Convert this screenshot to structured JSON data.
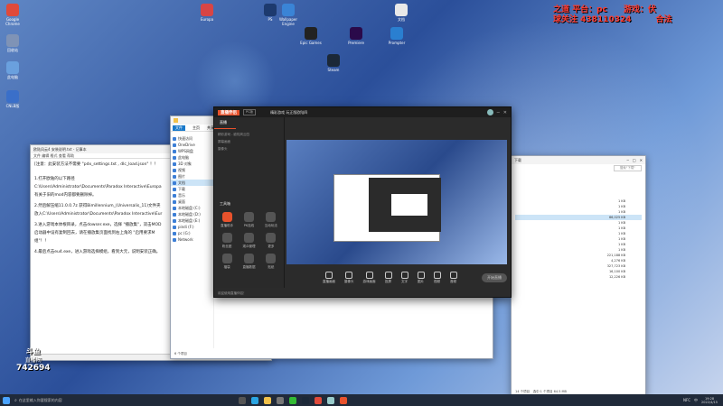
{
  "overlay": {
    "line1": "之道 平台：pc　　游戏：伏",
    "line2": "球关注 438110324　　　合法"
  },
  "desktop_icons": [
    {
      "label": "Google Chrome",
      "color": "#e04a3b"
    },
    {
      "label": "回收站",
      "color": "#7f93b6"
    },
    {
      "label": "此电脑",
      "color": "#6aa0de"
    },
    {
      "label": "CNLB版",
      "color": "#3a6fc9"
    },
    {
      "label": "Wallpaper Engine",
      "color": "#3a84d6"
    },
    {
      "label": "Epic Games",
      "color": "#222"
    },
    {
      "label": "Steam",
      "color": "#1b2838"
    },
    {
      "label": "Premiere",
      "color": "#2a0a4a"
    },
    {
      "label": "Prompter",
      "color": "#2a7fd0"
    },
    {
      "label": "Europa",
      "color": "#d84545"
    },
    {
      "label": "PS",
      "color": "#1d3a6e"
    },
    {
      "label": "文档",
      "color": "#e8e8e8"
    }
  ],
  "notepad": {
    "title": "欧陆风云4 安装说明.txt - 记事本",
    "lines": [
      "[注意：此安装方法不需要 \"pdx_settings.txt , dlc_load.json\" ！！",
      "1.打开欧陆的以下路径",
      "C:\\Users\\Administrator\\Documents\\Paradox Interactive\\Europa",
      "有关于旧的mod内容都要删除掉。",
      "2.然后解压缩11.0.0.7z 获得Bimillennium_(Universalis_11)文件夹",
      "放入C:\\Users\\Administrator\\Documents\\Paradox Interactive\\Eur",
      "3.进入游戏本体根目录，点击dowser.exe，选择 \"播放集\"，双击MOD",
      "启动器中设有复制回去，请在播放集页面找到右上角的 \"启用要求M",
      "组\"！！",
      "4.最后点击eu4.exe，进入游戏选择模组，看到大元，说明安装正确。"
    ],
    "status": [
      "第 1 行，第 1 列",
      "100%",
      "Windows (CRLF)",
      "ANSI"
    ]
  },
  "explorer": {
    "sidebar": [
      "快速访问",
      "OneDrive",
      "WPS网盘",
      "此电脑",
      "3D 对象",
      "视频",
      "图片",
      "文档",
      "下载",
      "音乐",
      "桌面",
      "本地磁盘 (C:)",
      "本地磁盘 (D:)",
      "本地磁盘 (E:)",
      "pindi (F:)",
      "pc (G:)",
      "Network"
    ],
    "selected_index": 7,
    "status": "6 个项目"
  },
  "streaming_app": {
    "title": "直播伴侣",
    "tab": "直播",
    "badge": "PC版",
    "stream_title": "精彩游戏 玩正版欧陆四",
    "scene_items": [
      "精彩游戏 - 欧陆风云四",
      "屏幕画面",
      "摄像头"
    ],
    "tools_header": "工具箱",
    "tools": [
      {
        "label": "直播助手",
        "color": "#e8522c"
      },
      {
        "label": "PK连线",
        "color": "#555"
      },
      {
        "label": "互动玩法",
        "color": "#555"
      },
      {
        "label": "粉丝团",
        "color": "#555"
      },
      {
        "label": "观众管理",
        "color": "#555"
      },
      {
        "label": "更多",
        "color": "#555"
      },
      {
        "label": "福袋",
        "color": "#555"
      },
      {
        "label": "直播数据",
        "color": "#555"
      },
      {
        "label": "贴纸",
        "color": "#555"
      }
    ],
    "bottom_tools": [
      "直播画面",
      "摄像头",
      "游戏画面",
      "投屏",
      "文字",
      "图片",
      "视频",
      "音频"
    ],
    "start_button": "开始直播",
    "notice": "欢迎使用直播伴侣！"
  },
  "explorer2": {
    "title": "下载",
    "status": "14 个项目　选中 1 个项目 64.5 MB",
    "files": [
      {
        "name": "",
        "date": "",
        "size": "1 KB"
      },
      {
        "name": "",
        "date": "",
        "size": "1 KB"
      },
      {
        "name": "",
        "date": "",
        "size": "1 KB"
      },
      {
        "name": "",
        "date": "",
        "size": "66,025 KB"
      },
      {
        "name": "",
        "date": "",
        "size": "1 KB"
      },
      {
        "name": "",
        "date": "",
        "size": "1 KB"
      },
      {
        "name": "",
        "date": "",
        "size": "1 KB"
      },
      {
        "name": "",
        "date": "",
        "size": "1 KB"
      },
      {
        "name": "",
        "date": "",
        "size": "1 KB"
      },
      {
        "name": "",
        "date": "",
        "size": "1 KB"
      },
      {
        "name": "",
        "date": "",
        "size": "221,188 KB"
      },
      {
        "name": "",
        "date": "",
        "size": "4,276 KB"
      },
      {
        "name": "",
        "date": "",
        "size": "327,723 KB"
      },
      {
        "name": "",
        "date": "",
        "size": "16,100 KB"
      },
      {
        "name": "",
        "date": "",
        "size": "12,226 KB"
      }
    ],
    "search": "搜索\"下载\""
  },
  "watermark": {
    "brand": "斗鱼",
    "sub": "直播间",
    "room_id": "742694"
  },
  "taskbar": {
    "search_placeholder": "在这里输入你要搜索的内容",
    "time": "19:28",
    "date": "2022/4/15",
    "lang": "中",
    "nfc": "NFC"
  }
}
